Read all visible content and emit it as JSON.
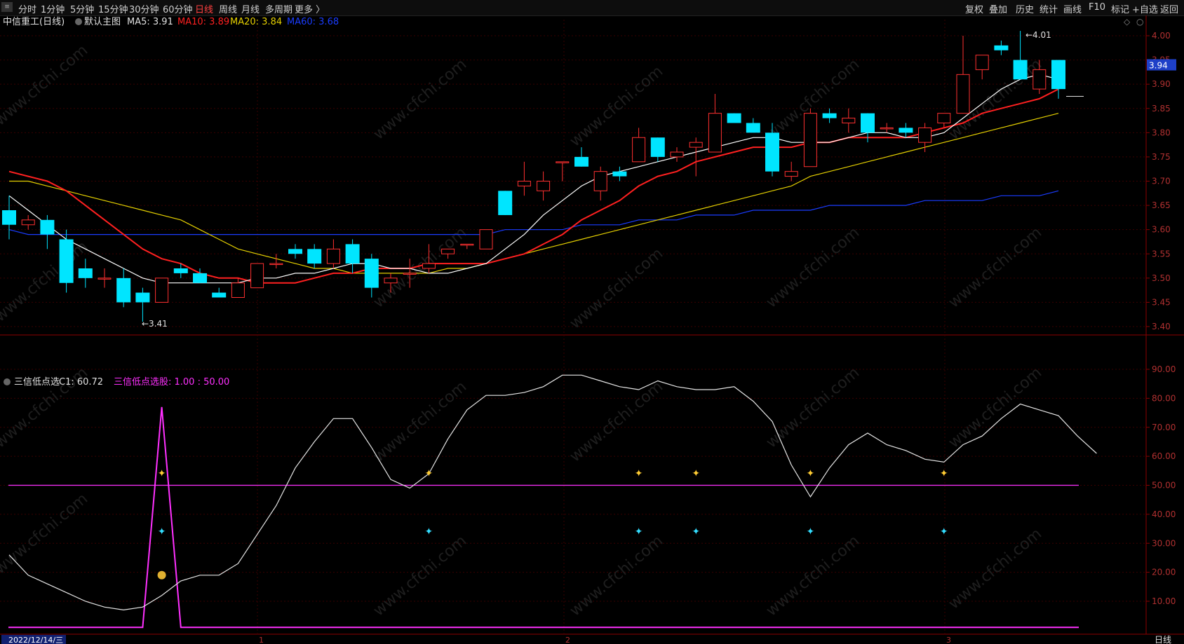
{
  "toolbar": {
    "periods": [
      "分时",
      "1分钟",
      "5分钟",
      "15分钟",
      "30分钟",
      "60分钟",
      "日线",
      "周线",
      "月线",
      "多周期",
      "更多 〉"
    ],
    "active_period": "日线",
    "right_buttons": [
      "复权",
      "叠加",
      "历史",
      "统计",
      "画线",
      "F10",
      "标记",
      "+自选",
      "返回"
    ]
  },
  "main_header": {
    "title": "中信重工(日线)",
    "template": "默认主图",
    "ma5": "MA5: 3.91",
    "ma10": "MA10: 3.89",
    "ma20": "MA20: 3.84",
    "ma60": "MA60: 3.68"
  },
  "sub_header": {
    "title": "三信低点选",
    "c1": "C1: 60.72",
    "signal": "三信低点选股: 1.00 : 50.00"
  },
  "date_label": "2022/12/14/三",
  "period_label": "日线",
  "watermark": "www.cfchi.com",
  "colors": {
    "up": "#ff3030",
    "down": "#00e5ff",
    "ma5": "#ffffff",
    "ma10": "#ff2020",
    "ma20": "#e5d000",
    "ma60": "#1a3cff",
    "magenta": "#ff30ff",
    "axis": "#8b0000"
  },
  "chart_data": [
    {
      "type": "candlestick",
      "y_ticks": [
        "4.00",
        "3.95",
        "3.90",
        "3.85",
        "3.80",
        "3.75",
        "3.70",
        "3.65",
        "3.60",
        "3.55",
        "3.50",
        "3.45",
        "3.40"
      ],
      "ylim": [
        3.38,
        4.03
      ],
      "current_price": "3.94",
      "high_label": "4.01",
      "low_label": "3.41",
      "x_ticks": [
        "1",
        "2",
        "3"
      ],
      "candles": [
        [
          3.64,
          3.67,
          3.58,
          3.61
        ],
        [
          3.61,
          3.63,
          3.6,
          3.62
        ],
        [
          3.62,
          3.63,
          3.56,
          3.59
        ],
        [
          3.58,
          3.6,
          3.47,
          3.49
        ],
        [
          3.52,
          3.54,
          3.48,
          3.5
        ],
        [
          3.5,
          3.52,
          3.48,
          3.5
        ],
        [
          3.5,
          3.52,
          3.44,
          3.45
        ],
        [
          3.47,
          3.48,
          3.41,
          3.45
        ],
        [
          3.45,
          3.5,
          3.45,
          3.5
        ],
        [
          3.52,
          3.53,
          3.5,
          3.51
        ],
        [
          3.51,
          3.52,
          3.49,
          3.49
        ],
        [
          3.47,
          3.48,
          3.46,
          3.46
        ],
        [
          3.46,
          3.5,
          3.46,
          3.49
        ],
        [
          3.48,
          3.53,
          3.48,
          3.53
        ],
        [
          3.53,
          3.55,
          3.52,
          3.53
        ],
        [
          3.56,
          3.57,
          3.54,
          3.55
        ],
        [
          3.56,
          3.57,
          3.52,
          3.53
        ],
        [
          3.53,
          3.58,
          3.52,
          3.56
        ],
        [
          3.57,
          3.58,
          3.51,
          3.53
        ],
        [
          3.54,
          3.55,
          3.46,
          3.48
        ],
        [
          3.49,
          3.51,
          3.47,
          3.5
        ],
        [
          3.51,
          3.54,
          3.48,
          3.51
        ],
        [
          3.52,
          3.57,
          3.51,
          3.53
        ],
        [
          3.55,
          3.56,
          3.54,
          3.56
        ],
        [
          3.57,
          3.57,
          3.56,
          3.57
        ],
        [
          3.56,
          3.6,
          3.56,
          3.6
        ],
        [
          3.68,
          3.68,
          3.63,
          3.63
        ],
        [
          3.69,
          3.74,
          3.67,
          3.7
        ],
        [
          3.68,
          3.72,
          3.66,
          3.7
        ],
        [
          3.74,
          3.74,
          3.7,
          3.74
        ],
        [
          3.75,
          3.77,
          3.73,
          3.73
        ],
        [
          3.68,
          3.73,
          3.66,
          3.72
        ],
        [
          3.72,
          3.73,
          3.7,
          3.71
        ],
        [
          3.74,
          3.81,
          3.74,
          3.79
        ],
        [
          3.79,
          3.79,
          3.74,
          3.75
        ],
        [
          3.75,
          3.77,
          3.74,
          3.76
        ],
        [
          3.77,
          3.79,
          3.71,
          3.78
        ],
        [
          3.76,
          3.88,
          3.76,
          3.84
        ],
        [
          3.84,
          3.84,
          3.82,
          3.82
        ],
        [
          3.82,
          3.83,
          3.8,
          3.8
        ],
        [
          3.8,
          3.82,
          3.71,
          3.72
        ],
        [
          3.71,
          3.74,
          3.7,
          3.72
        ],
        [
          3.73,
          3.85,
          3.73,
          3.84
        ],
        [
          3.84,
          3.85,
          3.82,
          3.83
        ],
        [
          3.82,
          3.85,
          3.8,
          3.83
        ],
        [
          3.84,
          3.84,
          3.78,
          3.8
        ],
        [
          3.81,
          3.82,
          3.8,
          3.81
        ],
        [
          3.81,
          3.82,
          3.79,
          3.8
        ],
        [
          3.78,
          3.82,
          3.76,
          3.81
        ],
        [
          3.82,
          3.84,
          3.81,
          3.84
        ],
        [
          3.84,
          4.0,
          3.84,
          3.92
        ],
        [
          3.93,
          3.95,
          3.91,
          3.96
        ],
        [
          3.98,
          3.99,
          3.96,
          3.97
        ],
        [
          3.95,
          4.01,
          3.91,
          3.91
        ],
        [
          3.89,
          3.95,
          3.88,
          3.93
        ],
        [
          3.95,
          3.95,
          3.87,
          3.89
        ]
      ],
      "ma5": [
        3.67,
        3.64,
        3.61,
        3.58,
        3.56,
        3.54,
        3.52,
        3.5,
        3.49,
        3.49,
        3.49,
        3.49,
        3.49,
        3.5,
        3.5,
        3.51,
        3.51,
        3.52,
        3.53,
        3.53,
        3.52,
        3.52,
        3.51,
        3.51,
        3.52,
        3.53,
        3.56,
        3.59,
        3.63,
        3.66,
        3.69,
        3.71,
        3.72,
        3.73,
        3.74,
        3.75,
        3.76,
        3.77,
        3.78,
        3.79,
        3.79,
        3.78,
        3.78,
        3.78,
        3.79,
        3.8,
        3.8,
        3.79,
        3.79,
        3.8,
        3.83,
        3.86,
        3.89,
        3.91,
        3.92,
        3.91
      ],
      "ma10": [
        3.72,
        3.71,
        3.7,
        3.68,
        3.65,
        3.62,
        3.59,
        3.56,
        3.54,
        3.53,
        3.51,
        3.5,
        3.5,
        3.49,
        3.49,
        3.49,
        3.5,
        3.51,
        3.51,
        3.52,
        3.52,
        3.52,
        3.53,
        3.53,
        3.53,
        3.53,
        3.54,
        3.55,
        3.57,
        3.59,
        3.62,
        3.64,
        3.66,
        3.69,
        3.71,
        3.72,
        3.74,
        3.75,
        3.76,
        3.77,
        3.77,
        3.77,
        3.78,
        3.78,
        3.79,
        3.79,
        3.79,
        3.79,
        3.8,
        3.81,
        3.82,
        3.84,
        3.85,
        3.86,
        3.87,
        3.89
      ],
      "ma20": [
        3.7,
        3.7,
        3.69,
        3.68,
        3.67,
        3.66,
        3.65,
        3.64,
        3.63,
        3.62,
        3.6,
        3.58,
        3.56,
        3.55,
        3.54,
        3.53,
        3.52,
        3.52,
        3.51,
        3.51,
        3.51,
        3.51,
        3.51,
        3.52,
        3.52,
        3.53,
        3.54,
        3.55,
        3.56,
        3.57,
        3.58,
        3.59,
        3.6,
        3.61,
        3.62,
        3.63,
        3.64,
        3.65,
        3.66,
        3.67,
        3.68,
        3.69,
        3.71,
        3.72,
        3.73,
        3.74,
        3.75,
        3.76,
        3.77,
        3.78,
        3.79,
        3.8,
        3.81,
        3.82,
        3.83,
        3.84
      ],
      "ma60": [
        3.6,
        3.59,
        3.59,
        3.59,
        3.59,
        3.59,
        3.59,
        3.59,
        3.59,
        3.59,
        3.59,
        3.59,
        3.59,
        3.59,
        3.59,
        3.59,
        3.59,
        3.59,
        3.59,
        3.59,
        3.59,
        3.59,
        3.59,
        3.59,
        3.59,
        3.59,
        3.6,
        3.6,
        3.6,
        3.6,
        3.61,
        3.61,
        3.61,
        3.62,
        3.62,
        3.62,
        3.63,
        3.63,
        3.63,
        3.64,
        3.64,
        3.64,
        3.64,
        3.65,
        3.65,
        3.65,
        3.65,
        3.65,
        3.66,
        3.66,
        3.66,
        3.66,
        3.67,
        3.67,
        3.67,
        3.68
      ]
    },
    {
      "type": "line",
      "y_ticks": [
        "90.00",
        "80.00",
        "70.00",
        "60.00",
        "50.00",
        "40.00",
        "30.00",
        "20.00",
        "10.00"
      ],
      "ylim": [
        0,
        100
      ],
      "c1": [
        26,
        19,
        16,
        13,
        10,
        8,
        7,
        8,
        12,
        17,
        19,
        19,
        23,
        33,
        43,
        56,
        65,
        73,
        73,
        63,
        52,
        49,
        54,
        66,
        76,
        81,
        81,
        82,
        84,
        88,
        88,
        86,
        84,
        83,
        86,
        84,
        83,
        83,
        84,
        79,
        72,
        57,
        46,
        56,
        64,
        68,
        64,
        62,
        59,
        58,
        64,
        67,
        73,
        78,
        76,
        74,
        67,
        61
      ],
      "signal_line_value": 50,
      "pulse": {
        "base": 1,
        "peak": 77,
        "index": 8
      },
      "butterfly_indices_gold": [
        8,
        22,
        33,
        36,
        42,
        49
      ],
      "butterfly_indices_cyan": [
        8,
        22,
        33,
        36,
        42,
        49
      ],
      "money_bag_index": 8
    }
  ]
}
